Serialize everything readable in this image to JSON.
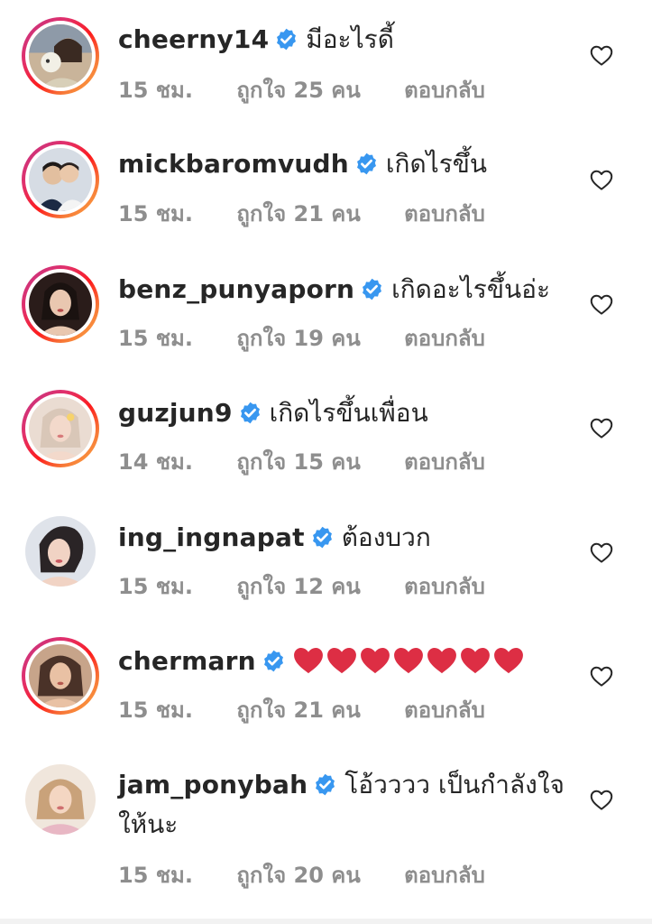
{
  "colors": {
    "verified": "#3897f0",
    "meta": "#8e8e8e",
    "heart_emoji": "#dd2e44",
    "ring_start": "#c13584",
    "ring_end": "#fcaf45"
  },
  "comments": [
    {
      "username": "cheerny14",
      "verified": true,
      "text": "มีอะไรดี้",
      "time": "15 ชม.",
      "likes": "ถูกใจ 25 คน",
      "reply": "ตอบกลับ",
      "story_ring": true
    },
    {
      "username": "mickbaromvudh",
      "verified": true,
      "text": "เกิดไรขึ้น",
      "time": "15 ชม.",
      "likes": "ถูกใจ 21 คน",
      "reply": "ตอบกลับ",
      "story_ring": true
    },
    {
      "username": "benz_punyaporn",
      "verified": true,
      "text": "เกิดอะไรขึ้นอ่ะ",
      "time": "15 ชม.",
      "likes": "ถูกใจ 19 คน",
      "reply": "ตอบกลับ",
      "story_ring": true
    },
    {
      "username": "guzjun9",
      "verified": true,
      "text": "เกิดไรขึ้นเพื่อน",
      "time": "14 ชม.",
      "likes": "ถูกใจ 15 คน",
      "reply": "ตอบกลับ",
      "story_ring": true
    },
    {
      "username": "ing_ingnapat",
      "verified": true,
      "text": "ต้องบวก",
      "time": "15 ชม.",
      "likes": "ถูกใจ 12 คน",
      "reply": "ตอบกลับ",
      "story_ring": false
    },
    {
      "username": "chermarn",
      "verified": true,
      "text": "",
      "emoji": "red-heart-emoji",
      "emoji_count": 7,
      "time": "15 ชม.",
      "likes": "ถูกใจ 21 คน",
      "reply": "ตอบกลับ",
      "story_ring": true
    },
    {
      "username": "jam_ponybah",
      "verified": true,
      "text": "โอ้วววว เป็นกำลังใจให้นะ",
      "time": "15 ชม.",
      "likes": "ถูกใจ 20 คน",
      "reply": "ตอบกลับ",
      "story_ring": false
    }
  ],
  "icons": {
    "like": "heart-outline-icon",
    "verified": "verified-badge-icon"
  }
}
